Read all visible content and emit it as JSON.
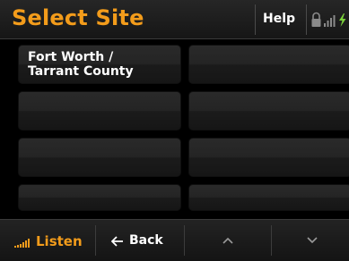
{
  "header": {
    "title": "Select Site",
    "help_label": "Help",
    "status_icons": [
      "lock-icon",
      "signal-strength-icon",
      "charging-bolt-icon"
    ]
  },
  "sites": [
    {
      "label": "Fort Worth /\nTarrant County"
    },
    {
      "label": ""
    },
    {
      "label": ""
    },
    {
      "label": ""
    },
    {
      "label": ""
    },
    {
      "label": ""
    },
    {
      "label": ""
    },
    {
      "label": ""
    }
  ],
  "bottom_bar": {
    "listen_label": "Listen",
    "back_label": "Back",
    "scroll_up_icon": "chevron-up-icon",
    "scroll_down_icon": "chevron-down-icon"
  },
  "colors": {
    "accent": "#f39c1b",
    "background": "#000000",
    "tile": "#242424",
    "text": "#ffffff",
    "charging": "#7bd13b"
  }
}
